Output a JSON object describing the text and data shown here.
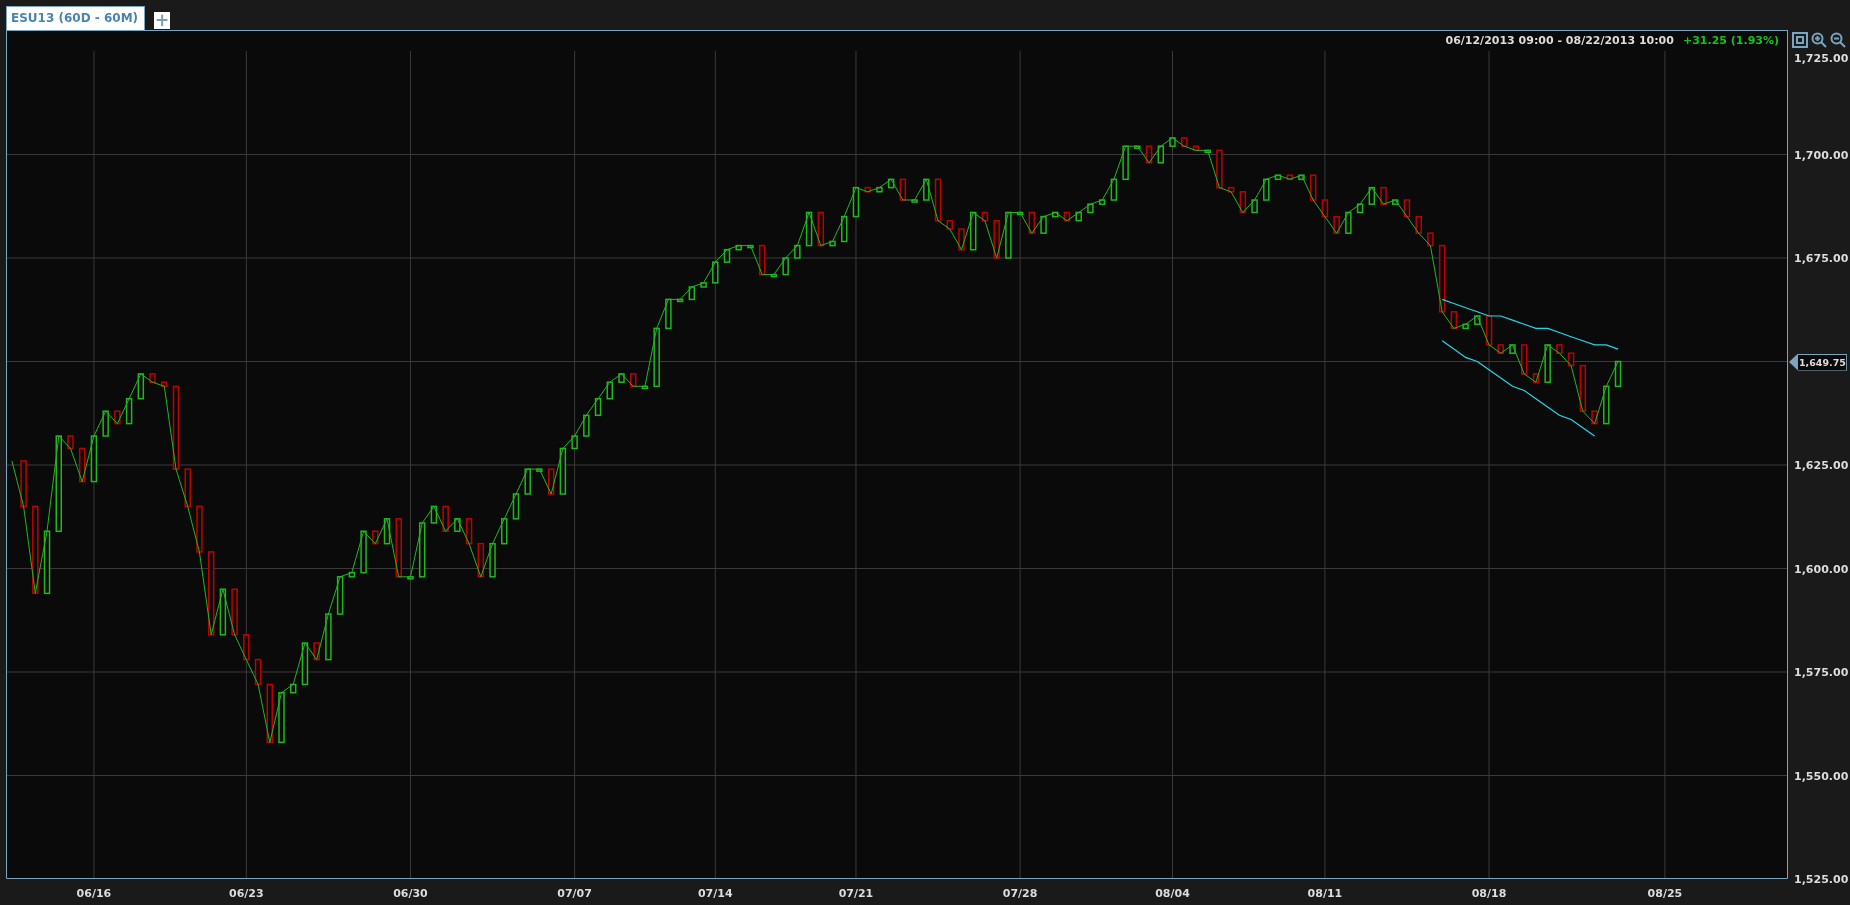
{
  "tabs": [
    {
      "label": "ESU13 (60D - 60M)",
      "selected": true
    }
  ],
  "add_tab_button": {
    "label": "+"
  },
  "chart_header": {
    "date_range": "06/12/2013 09:00 - 08/22/2013 10:00",
    "change": "+31.25 (1.93%)"
  },
  "last_price": {
    "label": "1,649.75"
  },
  "chart_data": {
    "type": "line",
    "grid": true,
    "categories": [
      null,
      null,
      null,
      null,
      null,
      null,
      null,
      "06/16",
      null,
      null,
      null,
      null,
      null,
      null,
      null,
      null,
      null,
      null,
      null,
      null,
      "06/23",
      null,
      null,
      null,
      null,
      null,
      null,
      null,
      null,
      null,
      null,
      null,
      null,
      null,
      "06/30",
      null,
      null,
      null,
      null,
      null,
      null,
      null,
      null,
      null,
      null,
      null,
      null,
      null,
      "07/07",
      null,
      null,
      null,
      null,
      null,
      null,
      null,
      null,
      null,
      null,
      null,
      "07/14",
      null,
      null,
      null,
      null,
      null,
      null,
      null,
      null,
      null,
      null,
      null,
      "07/21",
      null,
      null,
      null,
      null,
      null,
      null,
      null,
      null,
      null,
      null,
      null,
      null,
      null,
      "07/28",
      null,
      null,
      null,
      null,
      null,
      null,
      null,
      null,
      null,
      null,
      null,
      null,
      "08/04",
      null,
      null,
      null,
      null,
      null,
      null,
      null,
      null,
      null,
      null,
      null,
      null,
      "08/11",
      null,
      null,
      null,
      null,
      null,
      null,
      null,
      null,
      null,
      null,
      null,
      null,
      null,
      "08/18",
      null,
      null,
      null,
      null,
      null,
      null,
      null,
      null,
      null,
      null,
      null,
      null,
      null,
      null,
      "08/25",
      null,
      null,
      null,
      null,
      null,
      null,
      null,
      null,
      null,
      null
    ],
    "series": [
      {
        "color": "#1fb81f",
        "values": [
          1626,
          1615,
          1594,
          1609,
          1632,
          1629,
          1621,
          1632,
          1638,
          1635,
          1641,
          1647,
          1645,
          1644,
          1624,
          1615,
          1604,
          1584,
          1595,
          1584,
          1578,
          1572,
          1558,
          1570,
          1572,
          1582,
          1578,
          1589,
          1598,
          1599,
          1609,
          1606,
          1612,
          1598,
          1598,
          1611,
          1615,
          1609,
          1612,
          1606,
          1598,
          1606,
          1612,
          1618,
          1624,
          1624,
          1618,
          1629,
          1632,
          1637,
          1641,
          1645,
          1647,
          1644,
          1644,
          1658,
          1665,
          1665,
          1668,
          1669,
          1674,
          1677,
          1678,
          1678,
          1671,
          1671,
          1675,
          1678,
          1686,
          1678,
          1679,
          1685,
          1692,
          1691,
          1692,
          1694,
          1689,
          1689,
          1694,
          1684,
          1682,
          1677,
          1686,
          1684,
          1675,
          1686,
          1686,
          1681,
          1685,
          1686,
          1684,
          1686,
          1688,
          1689,
          1694,
          1702,
          1702,
          1698,
          1702,
          1704,
          1702,
          1701,
          1701,
          1692,
          1691,
          1686,
          1689,
          1694,
          1695,
          1694,
          1695,
          1689,
          1685,
          1681,
          1686,
          1688,
          1692,
          1688,
          1689,
          1685,
          1681,
          1678,
          1662,
          1658,
          1659,
          1661,
          1654,
          1652,
          1654,
          1647,
          1645,
          1654,
          1652,
          1649,
          1638,
          1635,
          1644,
          1650,
          null,
          null,
          null,
          null,
          null,
          null,
          null,
          null,
          null,
          null,
          null,
          null,
          null,
          null
        ]
      },
      {
        "color": "#22d8e8",
        "values": [
          null,
          null,
          null,
          null,
          null,
          null,
          null,
          null,
          null,
          null,
          null,
          null,
          null,
          null,
          null,
          null,
          null,
          null,
          null,
          null,
          null,
          null,
          null,
          null,
          null,
          null,
          null,
          null,
          null,
          null,
          null,
          null,
          null,
          null,
          null,
          null,
          null,
          null,
          null,
          null,
          null,
          null,
          null,
          null,
          null,
          null,
          null,
          null,
          null,
          null,
          null,
          null,
          null,
          null,
          null,
          null,
          null,
          null,
          null,
          null,
          null,
          null,
          null,
          null,
          null,
          null,
          null,
          null,
          null,
          null,
          null,
          null,
          null,
          null,
          null,
          null,
          null,
          null,
          null,
          null,
          null,
          null,
          null,
          null,
          null,
          null,
          null,
          null,
          null,
          null,
          null,
          null,
          null,
          null,
          null,
          null,
          null,
          null,
          null,
          null,
          null,
          null,
          null,
          null,
          null,
          null,
          null,
          null,
          null,
          null,
          null,
          null,
          null,
          null,
          null,
          null,
          null,
          null,
          null,
          null,
          null,
          null,
          1665,
          1664,
          1663,
          1662,
          1661,
          1661,
          1660,
          1659,
          1658,
          1658,
          1657,
          1656,
          1655,
          1654,
          1654,
          1653,
          null,
          null,
          null,
          null,
          null,
          null,
          null,
          null,
          null,
          null,
          null,
          null,
          null,
          null
        ]
      },
      {
        "color": "#22d8e8",
        "values": [
          null,
          null,
          null,
          null,
          null,
          null,
          null,
          null,
          null,
          null,
          null,
          null,
          null,
          null,
          null,
          null,
          null,
          null,
          null,
          null,
          null,
          null,
          null,
          null,
          null,
          null,
          null,
          null,
          null,
          null,
          null,
          null,
          null,
          null,
          null,
          null,
          null,
          null,
          null,
          null,
          null,
          null,
          null,
          null,
          null,
          null,
          null,
          null,
          null,
          null,
          null,
          null,
          null,
          null,
          null,
          null,
          null,
          null,
          null,
          null,
          null,
          null,
          null,
          null,
          null,
          null,
          null,
          null,
          null,
          null,
          null,
          null,
          null,
          null,
          null,
          null,
          null,
          null,
          null,
          null,
          null,
          null,
          null,
          null,
          null,
          null,
          null,
          null,
          null,
          null,
          null,
          null,
          null,
          null,
          null,
          null,
          null,
          null,
          null,
          null,
          null,
          null,
          null,
          null,
          null,
          null,
          null,
          null,
          null,
          null,
          null,
          null,
          null,
          null,
          null,
          null,
          null,
          null,
          null,
          null,
          null,
          null,
          1655,
          1653,
          1651,
          1650,
          1648,
          1646,
          1644,
          1643,
          1641,
          1639,
          1637,
          1636,
          1634,
          1632,
          null,
          null,
          null,
          null,
          null,
          null,
          null,
          null,
          null,
          null,
          null,
          null,
          null,
          null,
          null,
          null
        ]
      }
    ],
    "ylim": [
      1525,
      1725
    ],
    "yticks": [
      {
        "value": 1525,
        "label": "1,525.00"
      },
      {
        "value": 1550,
        "label": "1,550.00"
      },
      {
        "value": 1575,
        "label": "1,575.00"
      },
      {
        "value": 1600,
        "label": "1,600.00"
      },
      {
        "value": 1625,
        "label": "1,625.00"
      },
      {
        "value": 1675,
        "label": "1,675.00"
      },
      {
        "value": 1700,
        "label": "1,700.00"
      },
      {
        "value": 1725,
        "label": "1,725.00"
      }
    ]
  }
}
